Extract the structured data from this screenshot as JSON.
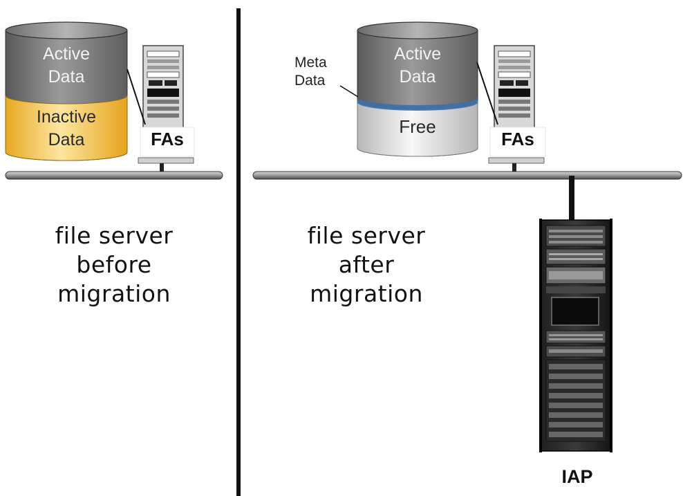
{
  "left_panel": {
    "disk_top_label": "Active\nData",
    "disk_bottom_label": "Inactive\nData",
    "server_label": "FAs",
    "caption": [
      "file server",
      "before",
      "migration"
    ]
  },
  "right_panel": {
    "disk_top_label": "Active\nData",
    "disk_bottom_label": "Free",
    "metadata_label": "Meta\nData",
    "server_label": "FAs",
    "caption": [
      "file server",
      "after",
      "migration"
    ],
    "archive_label": "IAP"
  },
  "colors": {
    "active_data": "#808080",
    "inactive_data": "#f5c33a",
    "free": "#e6e6e6",
    "metadata_band": "#3b6fa5"
  }
}
